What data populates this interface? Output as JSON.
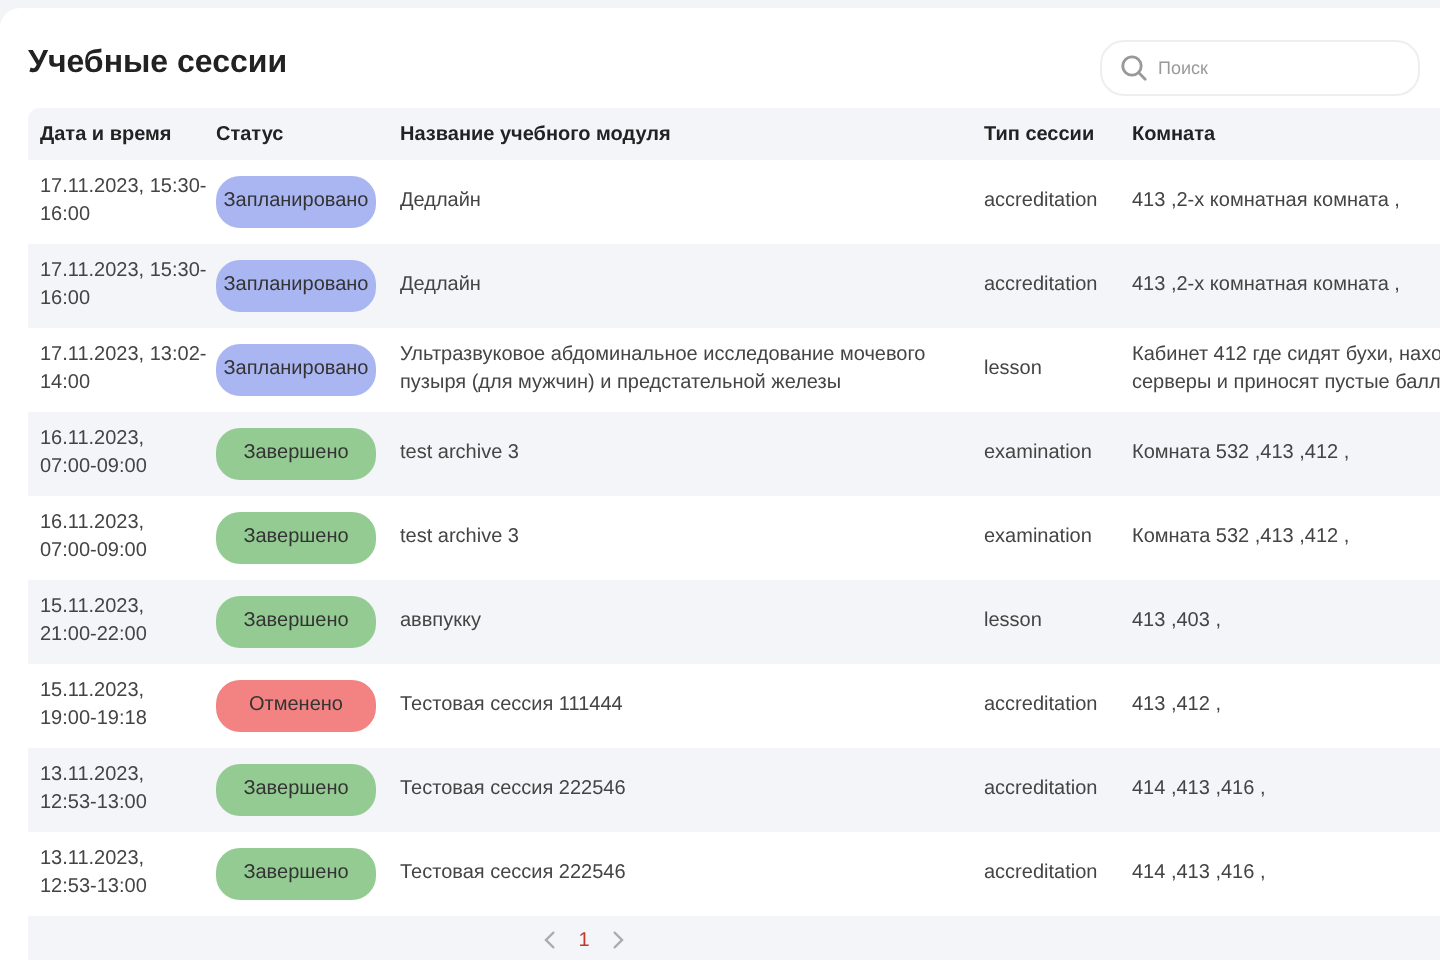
{
  "title": "Учебные сессии",
  "search": {
    "placeholder": "Поиск"
  },
  "columns": [
    "Дата и время",
    "Статус",
    "Название учебного модуля",
    "Тип сессии",
    "Комната"
  ],
  "rows": [
    {
      "date": "17.11.2023, 15:30-\n16:00",
      "status": {
        "kind": "planned",
        "label": "Запланировано"
      },
      "name": "Дедлайн",
      "type": "accreditation",
      "room": "413 ,2-х комнатная комната ,"
    },
    {
      "date": "17.11.2023, 15:30-\n16:00",
      "status": {
        "kind": "planned",
        "label": "Запланировано"
      },
      "name": "Дедлайн",
      "type": "accreditation",
      "room": "413 ,2-х комнатная комната ,"
    },
    {
      "date": "17.11.2023, 13:02-\n14:00",
      "status": {
        "kind": "planned",
        "label": "Запланировано"
      },
      "name": "Ультразвуковое абдоминальное исследование мочевого\nпузыря (для мужчин) и предстательной железы",
      "type": "lesson",
      "room": "Кабинет 412 где сидят бухи, нахо\nсерверы и приносят пустые балл"
    },
    {
      "date": "16.11.2023,\n07:00-09:00",
      "status": {
        "kind": "done",
        "label": "Завершено"
      },
      "name": "test archive 3",
      "type": "examination",
      "room": "Комната 532 ,413 ,412 ,"
    },
    {
      "date": "16.11.2023,\n07:00-09:00",
      "status": {
        "kind": "done",
        "label": "Завершено"
      },
      "name": "test archive 3",
      "type": "examination",
      "room": "Комната 532 ,413 ,412 ,"
    },
    {
      "date": "15.11.2023,\n21:00-22:00",
      "status": {
        "kind": "done",
        "label": "Завершено"
      },
      "name": "аввпукку",
      "type": "lesson",
      "room": "413 ,403 ,"
    },
    {
      "date": "15.11.2023,\n19:00-19:18",
      "status": {
        "kind": "cancelled",
        "label": "Отменено"
      },
      "name": "Тестовая сессия 111444",
      "type": "accreditation",
      "room": "413 ,412 ,"
    },
    {
      "date": "13.11.2023,\n12:53-13:00",
      "status": {
        "kind": "done",
        "label": "Завершено"
      },
      "name": "Тестовая сессия 222546",
      "type": "accreditation",
      "room": "414 ,413 ,416 ,"
    },
    {
      "date": "13.11.2023,\n12:53-13:00",
      "status": {
        "kind": "done",
        "label": "Завершено"
      },
      "name": "Тестовая сессия 222546",
      "type": "accreditation",
      "room": "414 ,413 ,416 ,"
    }
  ],
  "pagination": {
    "pages": [
      {
        "label": "1",
        "selected": true
      }
    ]
  }
}
